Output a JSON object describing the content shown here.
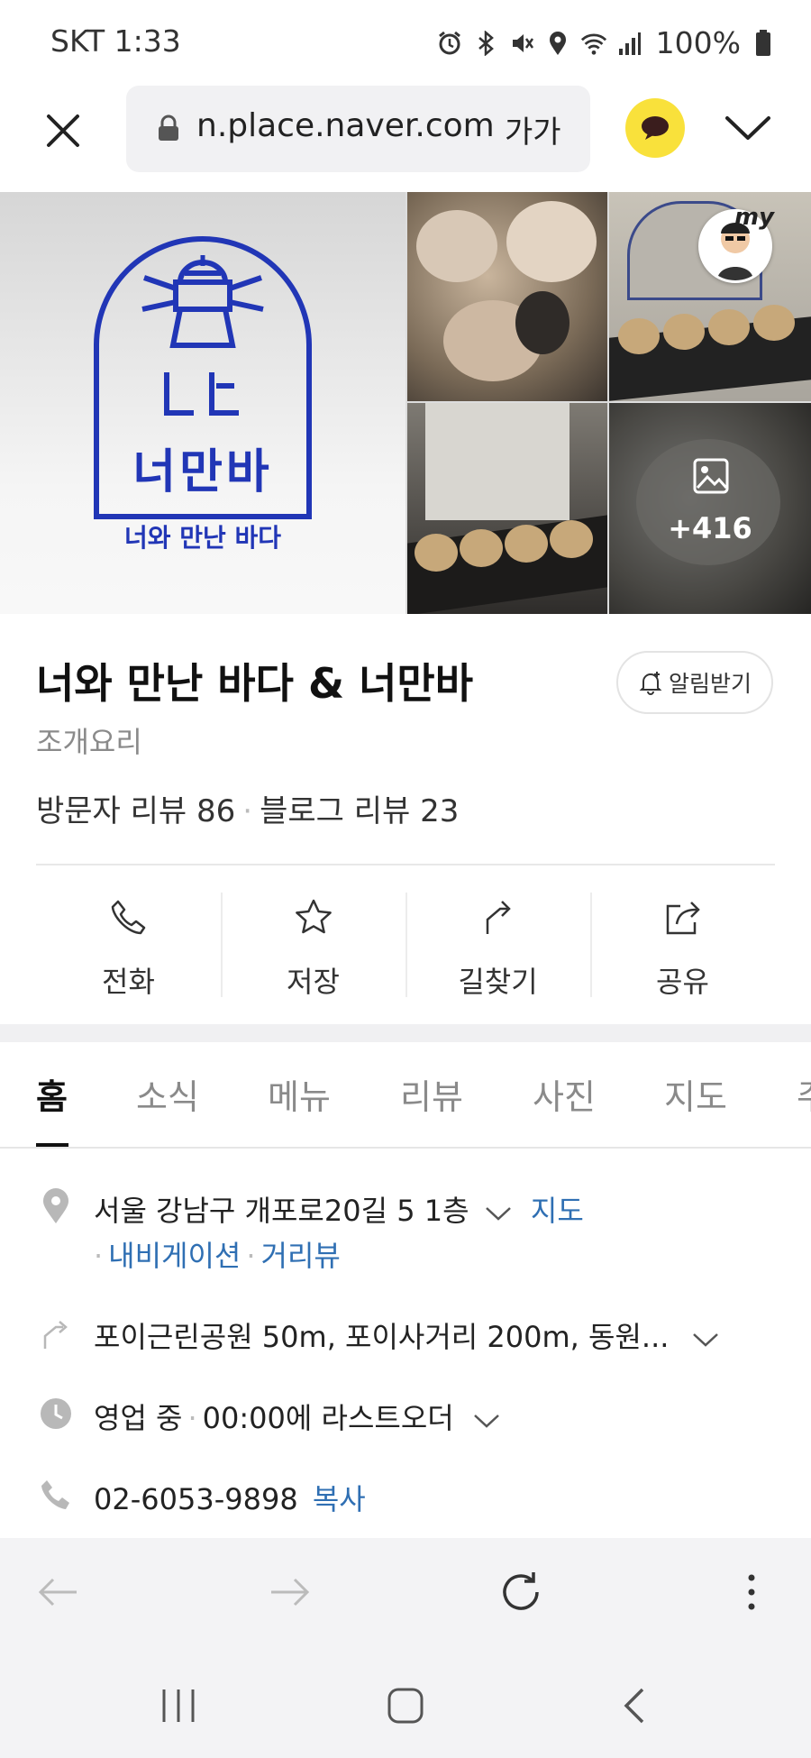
{
  "status_bar": {
    "time": "SKT 1:33",
    "battery": "100%",
    "icons": [
      "alarm-icon",
      "bluetooth-icon",
      "mute-icon",
      "location-icon",
      "wifi-icon",
      "signal-icon",
      "battery-icon"
    ]
  },
  "browser": {
    "url": "n.place.naver.com",
    "font_size_button": "가가",
    "accent_color": "#f9e13b"
  },
  "gallery": {
    "logo_name": "너만바",
    "logo_tagline": "너와 만난 바다",
    "photo_more": "+416",
    "avatar_tag": "my"
  },
  "place": {
    "title": "너와 만난 바다 & 너만바",
    "category": "조개요리",
    "visitor_reviews": "방문자 리뷰 86",
    "blog_reviews": "블로그 리뷰 23",
    "alarm_label": "알림받기"
  },
  "actions": [
    {
      "label": "전화",
      "icon": "phone-icon"
    },
    {
      "label": "저장",
      "icon": "star-icon"
    },
    {
      "label": "길찾기",
      "icon": "directions-icon"
    },
    {
      "label": "공유",
      "icon": "share-icon"
    }
  ],
  "tabs": [
    "홈",
    "소식",
    "메뉴",
    "리뷰",
    "사진",
    "지도",
    "주"
  ],
  "details": {
    "address": "서울 강남구 개포로20길 5 1층",
    "map_link": "지도",
    "navigation_link": "내비게이션",
    "streetview_link": "거리뷰",
    "directions": "포이근린공원 50m, 포이사거리 200m, 동원...",
    "hours_status": "영업 중",
    "hours_note": "00:00에 라스트오더",
    "phone": "02-6053-9898",
    "copy_link": "복사",
    "link_color": "#2f6fb3"
  }
}
